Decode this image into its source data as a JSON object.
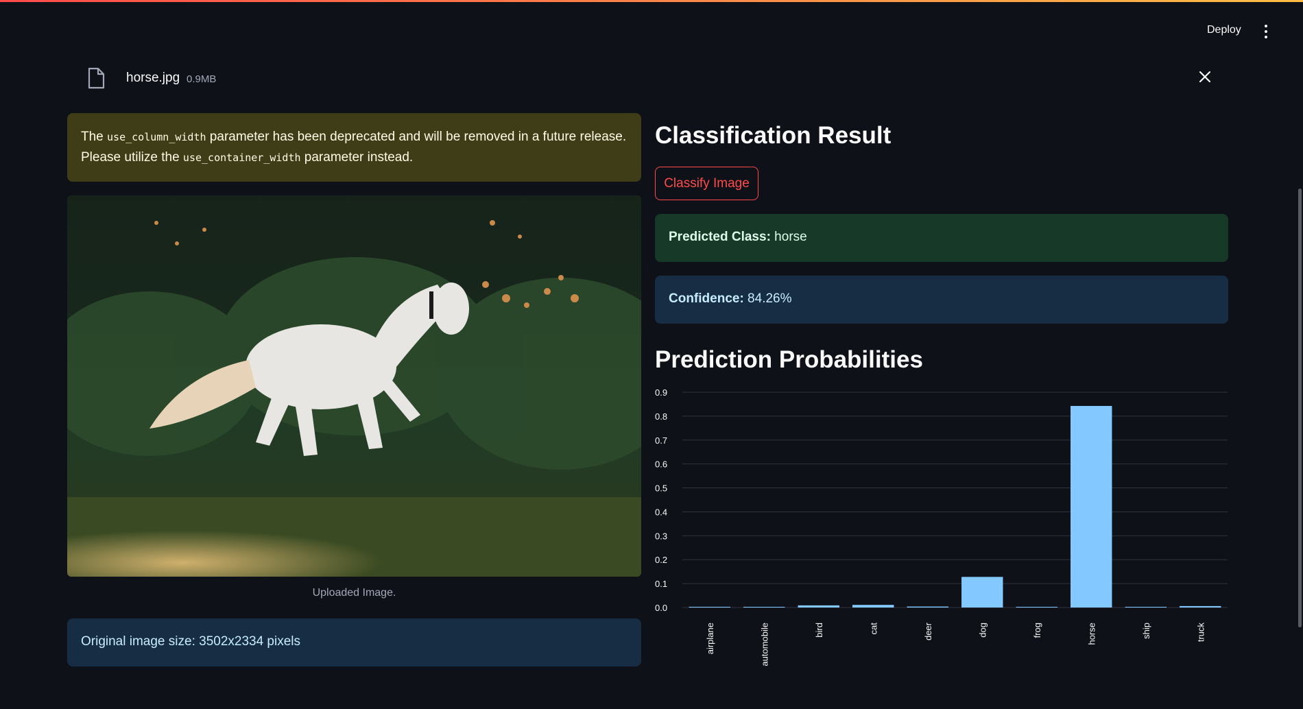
{
  "header": {
    "deploy_label": "Deploy"
  },
  "file": {
    "name": "horse.jpg",
    "size": "0.9MB"
  },
  "warning": {
    "part1": "The ",
    "code1": "use_column_width",
    "part2": " parameter has been deprecated and will be removed in a future release.",
    "part3": "Please utilize the ",
    "code2": "use_container_width",
    "part4": " parameter instead."
  },
  "image": {
    "caption": "Uploaded Image.",
    "alt": "white horse galloping in front of a dark hedge"
  },
  "info": {
    "original_size": "Original image size: 3502x2334 pixels"
  },
  "result": {
    "heading": "Classification Result",
    "button_label": "Classify Image",
    "predicted_label": "Predicted Class:",
    "predicted_value": " horse",
    "confidence_label": "Confidence:",
    "confidence_value": " 84.26%"
  },
  "probs": {
    "heading": "Prediction Probabilities"
  },
  "colors": {
    "bar": "#83c9ff",
    "accent": "#ff4b4b",
    "success_bg": "#173928",
    "info_bg": "#172d43",
    "warning_bg": "#3f3d17"
  },
  "chart_data": {
    "type": "bar",
    "categories": [
      "airplane",
      "automobile",
      "bird",
      "cat",
      "deer",
      "dog",
      "frog",
      "horse",
      "ship",
      "truck"
    ],
    "values": [
      0.003,
      0.0005,
      0.009,
      0.011,
      0.004,
      0.128,
      0.001,
      0.8426,
      0.001,
      0.006
    ],
    "yticks": [
      "0.0",
      "0.1",
      "0.2",
      "0.3",
      "0.4",
      "0.5",
      "0.6",
      "0.7",
      "0.8",
      "0.9"
    ],
    "ylim": [
      0,
      0.9
    ],
    "grid": true,
    "title": "",
    "xlabel": "",
    "ylabel": ""
  }
}
